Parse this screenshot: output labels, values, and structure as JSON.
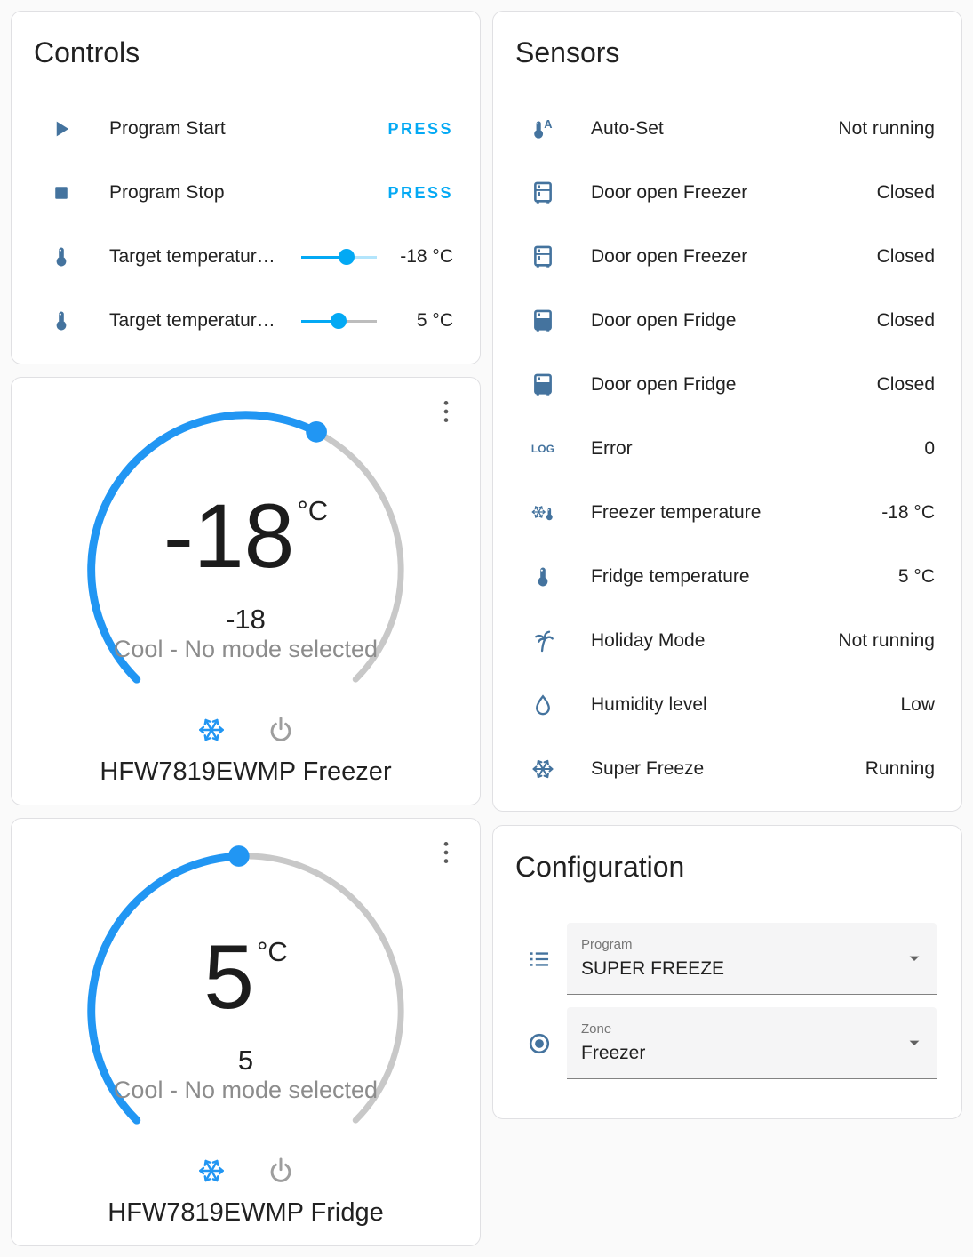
{
  "colors": {
    "page_bg": "#fafafa",
    "card_bg": "#ffffff",
    "border": "#e0e0e3",
    "accent": "#03a9f4",
    "dial": "#2196f3",
    "dial_track": "#c8c8c8",
    "icon": "#44739e",
    "inactive": "#9e9e9e",
    "text_primary": "#212121",
    "text_secondary": "#757575"
  },
  "controls": {
    "title": "Controls",
    "rows": [
      {
        "icon": "#i-play",
        "icon_name": "play-icon",
        "label": "Program Start",
        "action": "PRESS"
      },
      {
        "icon": "#i-stop",
        "icon_name": "stop-icon",
        "label": "Program Stop",
        "action": "PRESS"
      },
      {
        "icon": "#i-thermometer",
        "icon_name": "thermometer-icon",
        "label": "Target temperatur…",
        "value": "-18 °C",
        "slider": {
          "fraction": 0.6,
          "rest_color": "#b3e5fc"
        }
      },
      {
        "icon": "#i-thermometer",
        "icon_name": "thermometer-icon",
        "label": "Target temperatur…",
        "value": "5 °C",
        "slider": {
          "fraction": 0.49,
          "rest_color": "#bdbdbd"
        }
      }
    ]
  },
  "thermostats": [
    {
      "name": "HFW7819EWMP Freezer",
      "target": "-18",
      "unit": "°C",
      "current": "-18",
      "mode_text": "Cool - No mode selected",
      "dial_fraction": 0.6,
      "modes": [
        {
          "icon": "#i-snowflake",
          "icon_name": "snowflake-cool-icon"
        },
        {
          "icon": "#i-power",
          "icon_name": "power-icon"
        }
      ]
    },
    {
      "name": "HFW7819EWMP Fridge",
      "target": "5",
      "unit": "°C",
      "current": "5",
      "mode_text": "Cool - No mode selected",
      "dial_fraction": 0.49,
      "modes": [
        {
          "icon": "#i-snowflake",
          "icon_name": "snowflake-cool-icon"
        },
        {
          "icon": "#i-power",
          "icon_name": "power-icon"
        }
      ]
    }
  ],
  "sensors": {
    "title": "Sensors",
    "rows": [
      {
        "icon": "#i-thermo-auto",
        "icon_name": "thermometer-auto-icon",
        "label": "Auto-Set",
        "value": "Not running"
      },
      {
        "icon": "#i-fridge-outline",
        "icon_name": "fridge-outline-icon",
        "label": "Door open Freezer",
        "value": "Closed"
      },
      {
        "icon": "#i-fridge-outline",
        "icon_name": "fridge-outline-icon",
        "label": "Door open Freezer",
        "value": "Closed"
      },
      {
        "icon": "#i-fridge-bottom",
        "icon_name": "fridge-bottom-icon",
        "label": "Door open Fridge",
        "value": "Closed"
      },
      {
        "icon": "#i-fridge-bottom",
        "icon_name": "fridge-bottom-icon",
        "label": "Door open Fridge",
        "value": "Closed"
      },
      {
        "icon": "#i-log",
        "icon_name": "log-icon",
        "label": "Error",
        "value": "0"
      },
      {
        "icon": "#i-snow-thermo",
        "icon_name": "snowflake-thermometer-icon",
        "label": "Freezer temperature",
        "value": "-18 °C"
      },
      {
        "icon": "#i-thermometer",
        "icon_name": "thermometer-icon",
        "label": "Fridge temperature",
        "value": "5 °C"
      },
      {
        "icon": "#i-palm",
        "icon_name": "palm-tree-icon",
        "label": "Holiday Mode",
        "value": "Not running"
      },
      {
        "icon": "#i-droplet",
        "icon_name": "water-drop-icon",
        "label": "Humidity level",
        "value": "Low"
      },
      {
        "icon": "#i-snowflake",
        "icon_name": "snowflake-icon",
        "label": "Super Freeze",
        "value": "Running"
      }
    ]
  },
  "configuration": {
    "title": "Configuration",
    "fields": [
      {
        "icon": "#i-list",
        "icon_name": "format-list-icon",
        "label": "Program",
        "value": "SUPER FREEZE"
      },
      {
        "icon": "#i-radio",
        "icon_name": "radiobox-marked-icon",
        "label": "Zone",
        "value": "Freezer"
      }
    ]
  }
}
